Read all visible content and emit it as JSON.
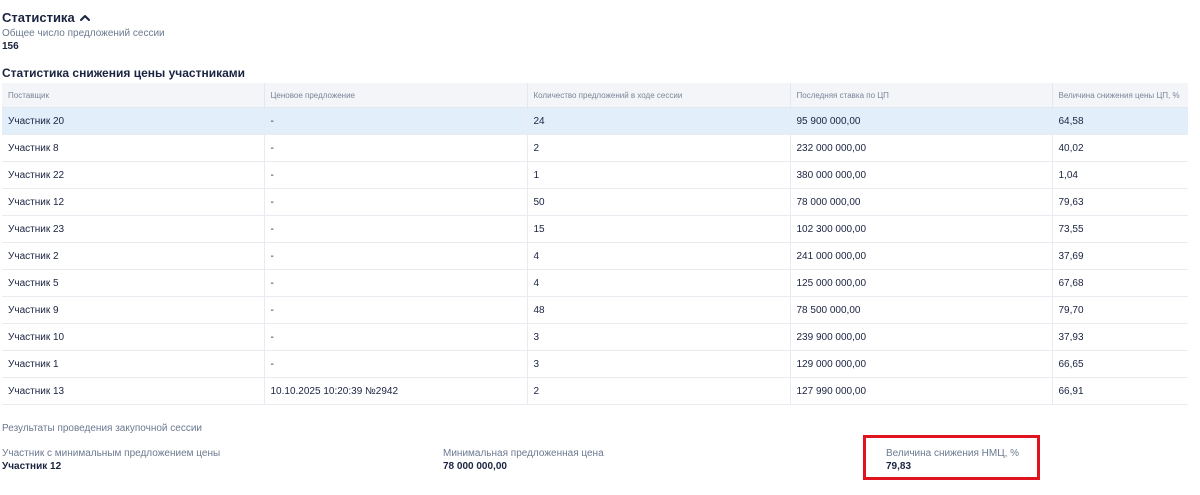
{
  "stats": {
    "title": "Статистика",
    "total_label": "Общее число предложений сессии",
    "total_value": "156"
  },
  "table": {
    "title": "Статистика снижения цены участниками",
    "columns": [
      "Поставщик",
      "Ценовое предложение",
      "Количество предложений в ходе сессии",
      "Последняя ставка по ЦП",
      "Величина снижения цены ЦП, %"
    ],
    "rows": [
      [
        "Участник 20",
        "-",
        "24",
        "95 900 000,00",
        "64,58"
      ],
      [
        "Участник 8",
        "-",
        "2",
        "232 000 000,00",
        "40,02"
      ],
      [
        "Участник 22",
        "-",
        "1",
        "380 000 000,00",
        "1,04"
      ],
      [
        "Участник 12",
        "-",
        "50",
        "78 000 000,00",
        "79,63"
      ],
      [
        "Участник 23",
        "-",
        "15",
        "102 300 000,00",
        "73,55"
      ],
      [
        "Участник 2",
        "-",
        "4",
        "241 000 000,00",
        "37,69"
      ],
      [
        "Участник 5",
        "-",
        "4",
        "125 000 000,00",
        "67,68"
      ],
      [
        "Участник 9",
        "-",
        "48",
        "78 500 000,00",
        "79,70"
      ],
      [
        "Участник 10",
        "-",
        "3",
        "239 900 000,00",
        "37,93"
      ],
      [
        "Участник 1",
        "-",
        "3",
        "129 000 000,00",
        "66,65"
      ],
      [
        "Участник 13",
        "10.10.2025 10:20:39 №2942",
        "2",
        "127 990 000,00",
        "66,91"
      ]
    ]
  },
  "results": {
    "title": "Результаты проведения закупочной сессии",
    "min_participant_label": "Участник с минимальным предложением цены",
    "min_participant_value": "Участник 12",
    "min_price_label": "Минимальная предложенная цена",
    "min_price_value": "78 000 000,00",
    "nmc_reduction_label": "Величина снижения НМЦ, %",
    "nmc_reduction_value": "79,83"
  },
  "colors": {
    "selected_row": "#e3eefb",
    "highlight": "#e0141e",
    "text": "#1a2340",
    "muted": "#6b7a90"
  },
  "icons": {
    "toggle": "chevron-up-icon"
  }
}
